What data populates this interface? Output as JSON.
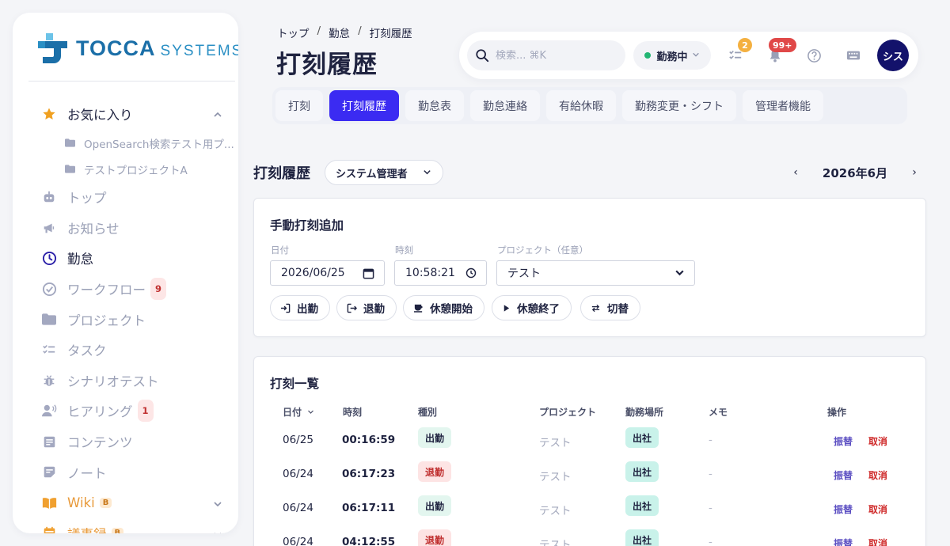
{
  "brand": {
    "name_a": "TOCCA",
    "name_b": "SYSTEMS",
    "accent": "#3b2bf2"
  },
  "sidebar": {
    "favorites": {
      "label": "お気に入り",
      "items": [
        "OpenSearch検索テスト用プ...",
        "テストプロジェクトA"
      ]
    },
    "items": [
      {
        "label": "トップ",
        "icon": "robot-icon"
      },
      {
        "label": "お知らせ",
        "icon": "megaphone-icon"
      },
      {
        "label": "勤怠",
        "icon": "clock-icon",
        "active": true
      },
      {
        "label": "ワークフロー",
        "icon": "check-circle-icon",
        "badge": "9"
      },
      {
        "label": "プロジェクト",
        "icon": "folder-icon"
      },
      {
        "label": "タスク",
        "icon": "checklist-icon"
      },
      {
        "label": "シナリオテスト",
        "icon": "bug-icon"
      },
      {
        "label": "ヒアリング",
        "icon": "user-voice-icon",
        "badge": "1"
      },
      {
        "label": "コンテンツ",
        "icon": "document-icon"
      },
      {
        "label": "ノート",
        "icon": "note-icon"
      }
    ],
    "wiki": {
      "label": "Wiki",
      "badge": "B"
    },
    "minutes": {
      "label": "議事録",
      "badge": "B"
    }
  },
  "header": {
    "breadcrumb": [
      "トップ",
      "勤怠",
      "打刻履歴"
    ],
    "title": "打刻履歴",
    "search_placeholder": "検索... ⌘K",
    "status": "勤務中",
    "task_badge": "2",
    "notif_badge": "99+",
    "avatar": "シス"
  },
  "tabs": [
    "打刻",
    "打刻履歴",
    "勤怠表",
    "勤怠連絡",
    "有給休暇",
    "勤務変更・シフト",
    "管理者機能"
  ],
  "section": {
    "title": "打刻履歴",
    "user_select": "システム管理者",
    "month": "2026年6月"
  },
  "manual": {
    "title": "手動打刻追加",
    "date_label": "日付",
    "date_value": "2026/06/25",
    "time_label": "時刻",
    "time_value": "10:58:21",
    "project_label": "プロジェクト（任意）",
    "project_value": "テスト",
    "buttons": [
      "出勤",
      "退勤",
      "休憩開始",
      "休憩終了",
      "切替"
    ]
  },
  "list": {
    "title": "打刻一覧",
    "columns": [
      "日付",
      "時刻",
      "種別",
      "プロジェクト",
      "勤務場所",
      "メモ",
      "操作"
    ],
    "rows": [
      {
        "date": "06/25",
        "time": "00:16:59",
        "type": "出勤",
        "kind": "in",
        "project": "テスト",
        "place": "出社",
        "memo": "-"
      },
      {
        "date": "06/24",
        "time": "06:17:23",
        "type": "退勤",
        "kind": "out",
        "project": "テスト",
        "place": "出社",
        "memo": "-"
      },
      {
        "date": "06/24",
        "time": "06:17:11",
        "type": "出勤",
        "kind": "in",
        "project": "テスト",
        "place": "出社",
        "memo": "-"
      },
      {
        "date": "06/24",
        "time": "04:12:55",
        "type": "退勤",
        "kind": "out",
        "project": "テスト",
        "place": "出社",
        "memo": "-"
      }
    ],
    "op_swap": "振替",
    "op_cancel": "取消"
  }
}
